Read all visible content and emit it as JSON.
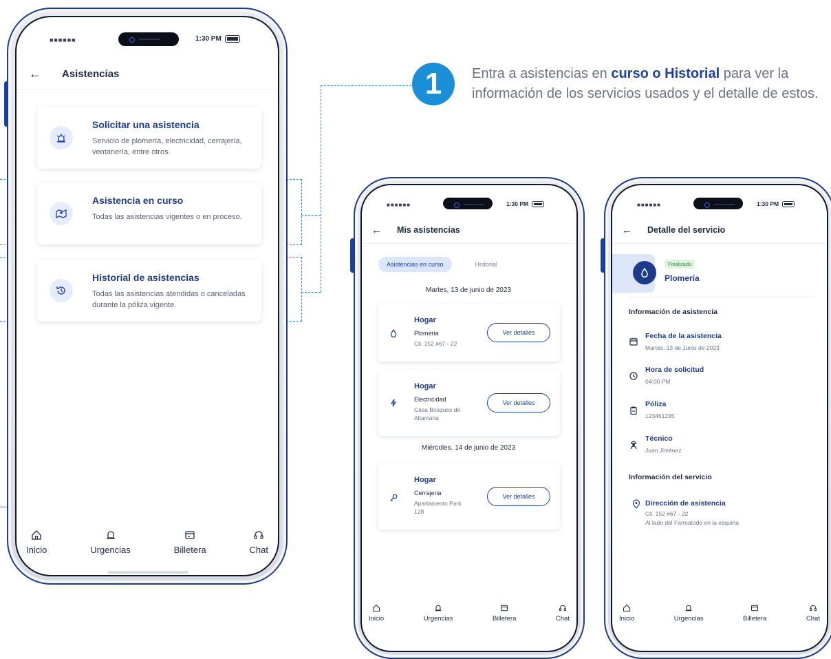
{
  "step": {
    "number": "1",
    "text_before": "Entra a asistencias en ",
    "text_bold": "curso o Historial",
    "text_after": " para ver la información de los servicios usados y el detalle de estos."
  },
  "status_bar": {
    "carrier": "■■■■■■",
    "time": "1:30 PM"
  },
  "phone1": {
    "title": "Asistencias",
    "cards": [
      {
        "title": "Solicitar una asistencia",
        "desc": "Servicio de plomería, electricidad, cerrajería, ventanería, entre otros.",
        "icon": "siren-icon"
      },
      {
        "title": "Asistencia en curso",
        "desc": "Todas las asistencias vigentes o en proceso.",
        "icon": "map-icon"
      },
      {
        "title": "Historial de asistencias",
        "desc": "Todas las asistencias atendidas o canceladas durante la póliza vigente.",
        "icon": "history-icon"
      }
    ]
  },
  "nav": {
    "inicio": "Inicio",
    "urgencias": "Urgencias",
    "billetera": "Billetera",
    "chat": "Chat"
  },
  "phone2": {
    "title": "Mis asistencias",
    "tabs": {
      "active": "Asistencias en curso",
      "inactive": "Historial"
    },
    "dates": [
      "Martes, 13 de junio de 2023",
      "Miércoles, 14 de junio de 2023"
    ],
    "items": [
      {
        "category": "Hogar",
        "service": "Plomeria",
        "address": "Cll. 152 #67 - 22",
        "icon": "drop-icon",
        "button": "Ver detalles"
      },
      {
        "category": "Hogar",
        "service": "Electricidad",
        "address": "Casa Bosques de Altamaria",
        "icon": "bolt-icon",
        "button": "Ver detalles"
      },
      {
        "category": "Hogar",
        "service": "Cerrajeria",
        "address": "Apartamento Park 128",
        "icon": "key-icon",
        "button": "Ver detalles"
      }
    ]
  },
  "phone3": {
    "title": "Detalle del servicio",
    "badge": "Finalizado",
    "service": "Plomería",
    "section1": "Información de asistencia",
    "fields": [
      {
        "label": "Fecha de la asistencia",
        "value": "Martes, 13 de Junio de 2023",
        "icon": "calendar-icon"
      },
      {
        "label": "Hora de solicitud",
        "value": "04:00 PM",
        "icon": "clock-icon"
      },
      {
        "label": "Póliza",
        "value": "123461235",
        "icon": "clipboard-icon"
      },
      {
        "label": "Técnico",
        "value": "Juan Jiménez",
        "icon": "technician-icon"
      }
    ],
    "section2": "Información del servicio",
    "address_label": "Dirección de asistencia",
    "address_line1": "Cll. 152 #67 - 22",
    "address_line2": "Al lado del Farmatodo en la esquina"
  },
  "colors": {
    "brand": "#1e3a8a",
    "accent": "#1a8fd8",
    "dash": "#2f7fd0",
    "success": "#2f8a3b"
  }
}
